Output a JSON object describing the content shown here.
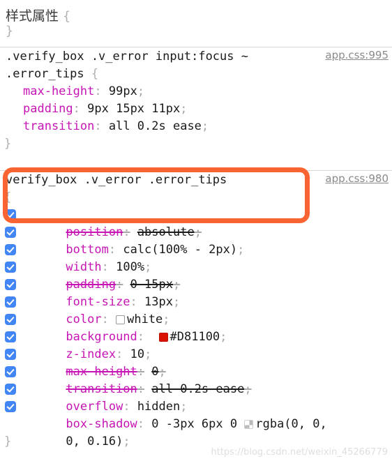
{
  "panel": {
    "title": "样式属性",
    "title_open_brace": "{",
    "title_close_brace": "}"
  },
  "rules": [
    {
      "selector": ".verify_box .v_error input:focus ~ .error_tips",
      "open_brace": "{",
      "close_brace": "}",
      "source": "app.css:995",
      "declarations": [
        {
          "name": "max-height",
          "colon": ":",
          "value": "99px",
          "semicolon": ";",
          "enabled": null,
          "struck": false
        },
        {
          "name": "padding",
          "colon": ":",
          "value": "9px 15px 11px",
          "semicolon": ";",
          "enabled": null,
          "struck": false
        },
        {
          "name": "transition",
          "colon": ":",
          "value": "all 0.2s ease",
          "semicolon": ";",
          "enabled": null,
          "struck": false
        }
      ]
    },
    {
      "selector": "verify_box .v_error .error_tips",
      "open_brace": "{",
      "close_brace": "}",
      "source": "app.css:980",
      "declarations": [
        {
          "name": "position",
          "colon": ":",
          "value": "absolute",
          "semicolon": ";",
          "enabled": true,
          "struck": true,
          "swatch": null
        },
        {
          "name": "bottom",
          "colon": ":",
          "value": "calc(100% - 2px)",
          "semicolon": ";",
          "enabled": true,
          "struck": false,
          "swatch": null
        },
        {
          "name": "width",
          "colon": ":",
          "value": "100%",
          "semicolon": ";",
          "enabled": true,
          "struck": false,
          "swatch": null
        },
        {
          "name": "padding",
          "colon": ":",
          "value": "0 15px",
          "semicolon": ";",
          "enabled": true,
          "struck": true,
          "swatch": null
        },
        {
          "name": "font-size",
          "colon": ":",
          "value": "13px",
          "semicolon": ";",
          "enabled": true,
          "struck": false,
          "swatch": null
        },
        {
          "name": "color",
          "colon": ":",
          "value": "white",
          "semicolon": ";",
          "enabled": true,
          "struck": false,
          "swatch": "white"
        },
        {
          "name": "background",
          "colon": ":",
          "value": "#D81100",
          "semicolon": ";",
          "enabled": true,
          "struck": false,
          "swatch": "red"
        },
        {
          "name": "z-index",
          "colon": ":",
          "value": "10",
          "semicolon": ";",
          "enabled": true,
          "struck": false,
          "swatch": null
        },
        {
          "name": "max-height",
          "colon": ":",
          "value": "0",
          "semicolon": ";",
          "enabled": true,
          "struck": true,
          "swatch": null
        },
        {
          "name": "transition",
          "colon": ":",
          "value": "all 0.2s ease",
          "semicolon": ";",
          "enabled": true,
          "struck": true,
          "swatch": null
        },
        {
          "name": "overflow",
          "colon": ":",
          "value": "hidden",
          "semicolon": ";",
          "enabled": true,
          "struck": false,
          "swatch": null
        },
        {
          "name": "box-shadow",
          "colon": ":",
          "value": "0 -3px 6px 0",
          "value_cont": "rgba(0, 0,",
          "value_wrap": "0, 0.16)",
          "semicolon": ";",
          "enabled": true,
          "struck": false,
          "swatch": "checker"
        }
      ]
    }
  ],
  "annotation": {
    "shape": "rounded-rectangle",
    "color": "#fa6432",
    "target": "verify_box .v_error .error_tips"
  },
  "watermark": "https://blog.csdn.net/weixin_45266779",
  "colors": {
    "property_name": "#c715b5",
    "checkbox_blue": "#4285f4",
    "annotation_orange": "#fa6432",
    "background_swatch": "#D81100",
    "divider": "#d6d6d6"
  }
}
